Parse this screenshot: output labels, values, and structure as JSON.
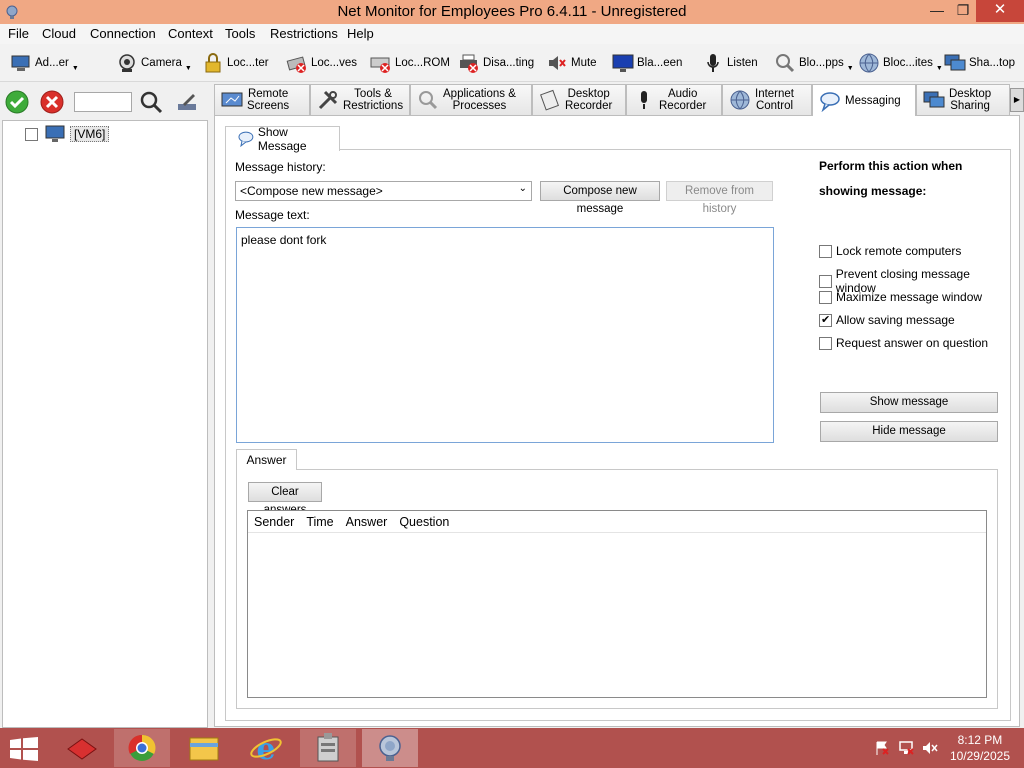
{
  "window": {
    "title": "Net Monitor for Employees Pro 6.4.11 - Unregistered"
  },
  "menu": [
    "File",
    "Cloud",
    "Connection",
    "Context",
    "Tools",
    "Restrictions",
    "Help"
  ],
  "toolbar": [
    {
      "label": "Ad...er",
      "icon": "admin-icon",
      "dropdown": true
    },
    {
      "label": "Camera",
      "icon": "camera-icon",
      "dropdown": true
    },
    {
      "label": "Loc...ter",
      "icon": "lock-computer-icon",
      "dropdown": false
    },
    {
      "label": "Loc...ves",
      "icon": "lock-drives-icon",
      "dropdown": false
    },
    {
      "label": "Loc...ROM",
      "icon": "lock-cdrom-icon",
      "dropdown": false
    },
    {
      "label": "Disa...ting",
      "icon": "disable-printing-icon",
      "dropdown": false
    },
    {
      "label": "Mute",
      "icon": "mute-icon",
      "dropdown": false
    },
    {
      "label": "Bla...een",
      "icon": "blank-screen-icon",
      "dropdown": false
    },
    {
      "label": "Listen",
      "icon": "microphone-icon",
      "dropdown": false
    },
    {
      "label": "Blo...pps",
      "icon": "block-apps-icon",
      "dropdown": true
    },
    {
      "label": "Bloc...ites",
      "icon": "block-sites-icon",
      "dropdown": true
    },
    {
      "label": "Sha...top",
      "icon": "share-desktop-icon",
      "dropdown": false
    }
  ],
  "tree": {
    "computer": "[VM6]",
    "checked": false
  },
  "search": {
    "value": ""
  },
  "tabs": [
    {
      "label": "Remote\nScreens",
      "icon": "remote-screens-icon"
    },
    {
      "label": "Tools &\nRestrictions",
      "icon": "tools-icon"
    },
    {
      "label": "Applications &\nProcesses",
      "icon": "applications-icon"
    },
    {
      "label": "Desktop\nRecorder",
      "icon": "desktop-recorder-icon"
    },
    {
      "label": "Audio\nRecorder",
      "icon": "audio-recorder-icon"
    },
    {
      "label": "Internet\nControl",
      "icon": "internet-control-icon"
    },
    {
      "label": "Messaging",
      "icon": "messaging-icon",
      "active": true
    },
    {
      "label": "Desktop\nSharing",
      "icon": "desktop-sharing-icon"
    }
  ],
  "messaging": {
    "subtab": "Show Message",
    "history_label": "Message history:",
    "history_selected": "<Compose new message>",
    "compose_button": "Compose new message",
    "remove_button": "Remove from history",
    "text_label": "Message text:",
    "message_text": "please dont fork",
    "action_title": "Perform this action when showing message:",
    "options": [
      {
        "label": "Lock remote computers",
        "checked": false
      },
      {
        "label": "Prevent closing message window",
        "checked": false
      },
      {
        "label": "Maximize message window",
        "checked": false
      },
      {
        "label": "Allow saving message",
        "checked": true
      },
      {
        "label": "Request answer on question",
        "checked": false
      }
    ],
    "show_button": "Show message",
    "hide_button": "Hide message",
    "answer_tab": "Answer",
    "clear_button": "Clear answers",
    "columns": [
      "Sender",
      "Time",
      "Answer",
      "Question"
    ],
    "answers": []
  },
  "taskbar": {
    "time": "8:12 PM",
    "date": "10/29/2025",
    "apps": [
      "start-icon",
      "app-red-icon",
      "chrome-icon",
      "file-explorer-icon",
      "internet-explorer-icon",
      "server-icon",
      "net-monitor-icon"
    ]
  }
}
